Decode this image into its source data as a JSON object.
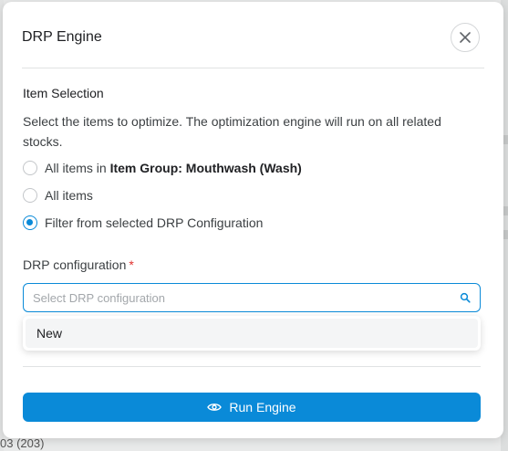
{
  "modal": {
    "title": "DRP Engine",
    "close_icon": "close-icon"
  },
  "item_selection": {
    "title": "Item Selection",
    "description": "Select the items to optimize. The optimization engine will run on all related stocks.",
    "options": [
      {
        "prefix": "All items in ",
        "bold": "Item Group: Mouthwash (Wash)",
        "checked": false
      },
      {
        "label": "All items",
        "checked": false
      },
      {
        "label": "Filter from selected DRP Configuration",
        "checked": true
      }
    ]
  },
  "drp_configuration": {
    "label": "DRP configuration",
    "required_mark": "*",
    "placeholder": "Select DRP configuration",
    "search_icon": "search-icon",
    "dropdown_options": [
      "New"
    ]
  },
  "actions": {
    "run_label": "Run Engine",
    "run_icon": "eye-icon"
  },
  "background": {
    "footer_text": "03 (203)"
  },
  "colors": {
    "accent": "#0a8ad8",
    "required": "#e0322e"
  }
}
